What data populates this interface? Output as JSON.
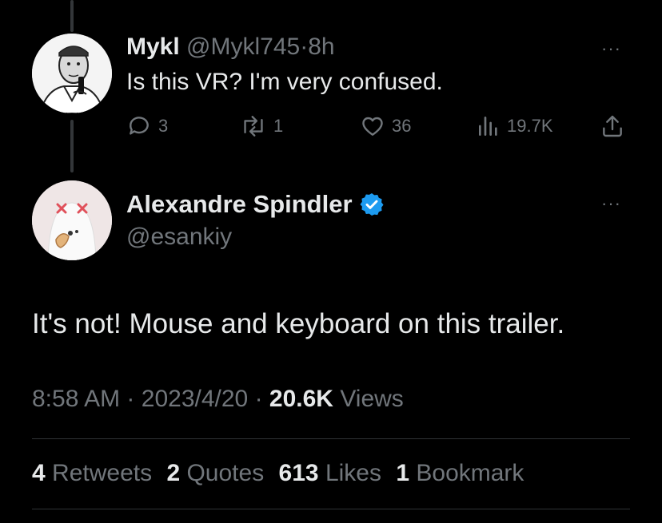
{
  "reply_tweet": {
    "display_name": "Mykl",
    "handle": "@Mykl745",
    "separator": "·",
    "time_ago": "8h",
    "text": "Is this VR? I'm very confused.",
    "more_label": "···",
    "actions": {
      "replies": "3",
      "retweets": "1",
      "likes": "36",
      "views": "19.7K"
    },
    "icons": [
      "reply-icon",
      "retweet-icon",
      "like-icon",
      "views-icon",
      "share-icon"
    ]
  },
  "main_tweet": {
    "display_name": "Alexandre Spindler",
    "handle": "@esankiy",
    "verified": true,
    "verified_color": "#1d9bf0",
    "more_label": "···",
    "text": "It's not! Mouse and keyboard on this trailer.",
    "time": "8:58 AM",
    "separator": "·",
    "date": "2023/4/20",
    "views_count": "20.6K",
    "views_label": "Views",
    "stats": {
      "retweets_count": "4",
      "retweets_label": "Retweets",
      "quotes_count": "2",
      "quotes_label": "Quotes",
      "likes_count": "613",
      "likes_label": "Likes",
      "bookmarks_count": "1",
      "bookmarks_label": "Bookmark"
    }
  },
  "colors": {
    "background": "#000000",
    "text_primary": "#e7e9ea",
    "text_muted": "#71767b",
    "divider": "#2f3336",
    "verified_badge": "#1d9bf0"
  }
}
